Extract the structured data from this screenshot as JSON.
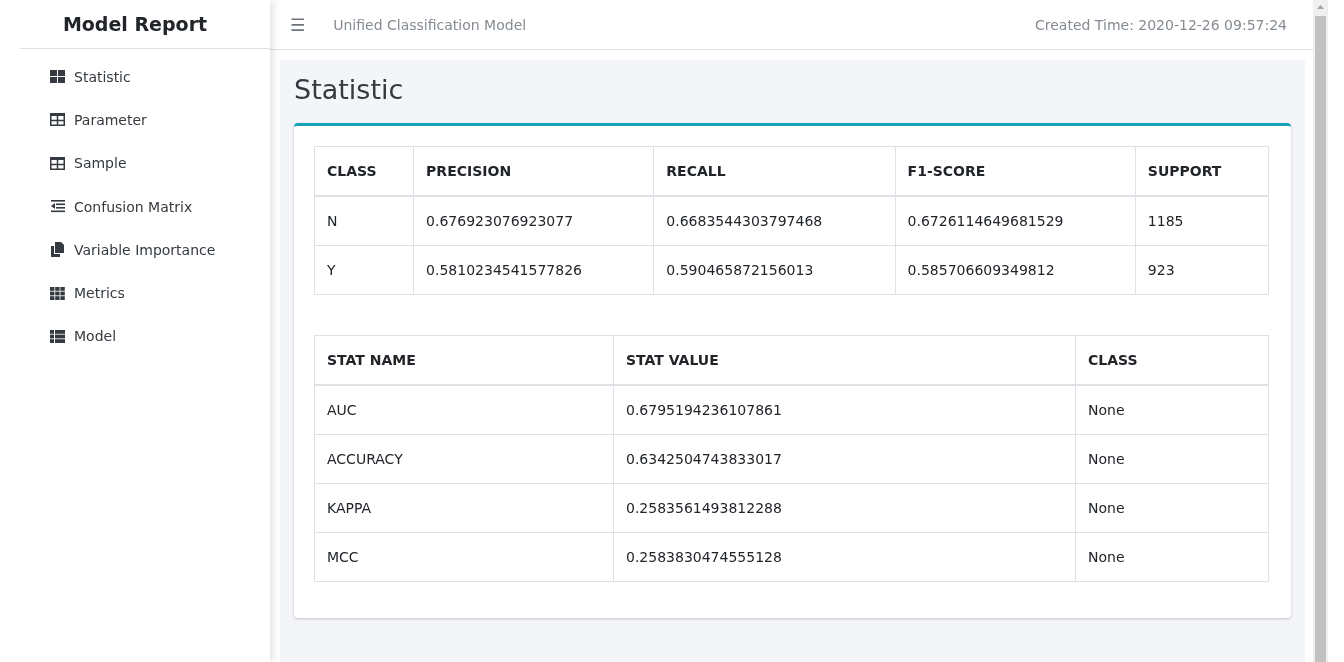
{
  "sidebar": {
    "title": "Model Report",
    "items": [
      {
        "label": "Statistic"
      },
      {
        "label": "Parameter"
      },
      {
        "label": "Sample"
      },
      {
        "label": "Confusion Matrix"
      },
      {
        "label": "Variable Importance"
      },
      {
        "label": "Metrics"
      },
      {
        "label": "Model"
      }
    ]
  },
  "topbar": {
    "menu_glyph": "☰",
    "title": "Unified Classification Model",
    "created_time": "Created Time: 2020-12-26 09:57:24"
  },
  "page": {
    "heading": "Statistic",
    "tables": [
      {
        "columns": [
          "CLASS",
          "PRECISION",
          "RECALL",
          "F1-SCORE",
          "SUPPORT"
        ],
        "rows": [
          [
            "N",
            "0.676923076923077",
            "0.6683544303797468",
            "0.6726114649681529",
            "1185"
          ],
          [
            "Y",
            "0.5810234541577826",
            "0.590465872156013",
            "0.585706609349812",
            "923"
          ]
        ]
      },
      {
        "columns": [
          "STAT NAME",
          "STAT VALUE",
          "CLASS"
        ],
        "rows": [
          [
            "AUC",
            "0.6795194236107861",
            "None"
          ],
          [
            "ACCURACY",
            "0.6342504743833017",
            "None"
          ],
          [
            "KAPPA",
            "0.2583561493812288",
            "None"
          ],
          [
            "MCC",
            "0.2583830474555128",
            "None"
          ]
        ]
      }
    ]
  }
}
